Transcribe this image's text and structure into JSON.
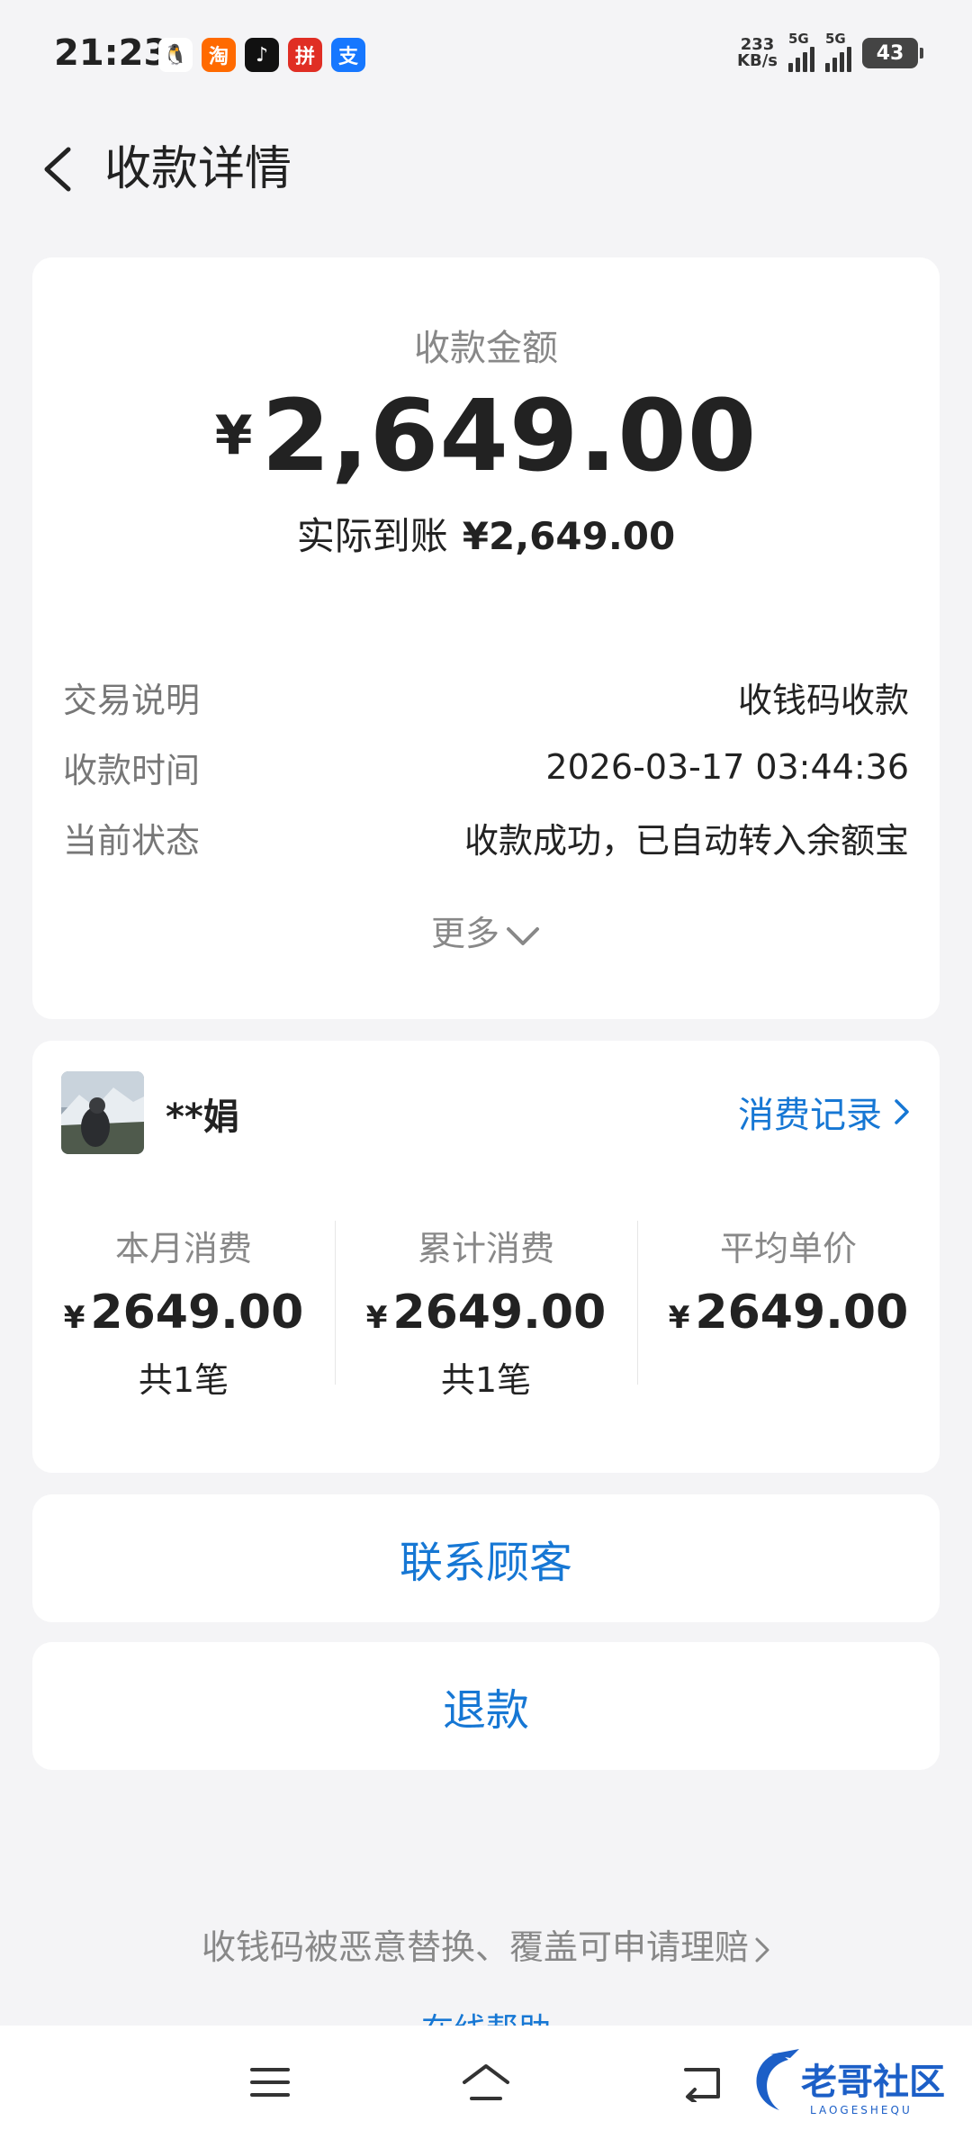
{
  "status_bar": {
    "time": "21:23",
    "apps": [
      {
        "name": "qq-icon",
        "glyph": "🐧",
        "bg": "#ffffff",
        "fg": "#111111"
      },
      {
        "name": "taobao-icon",
        "glyph": "淘",
        "bg": "#ff6a00",
        "fg": "#ffffff"
      },
      {
        "name": "tiktok-icon",
        "glyph": "♪",
        "bg": "#111111",
        "fg": "#ffffff"
      },
      {
        "name": "pinduoduo-icon",
        "glyph": "拼",
        "bg": "#e02e24",
        "fg": "#ffffff"
      },
      {
        "name": "alipay-icon",
        "glyph": "支",
        "bg": "#1677ff",
        "fg": "#ffffff"
      }
    ],
    "net_speed_value": "233",
    "net_speed_unit": "KB/s",
    "sim1": "5G",
    "sim2": "5G",
    "battery": "43"
  },
  "header": {
    "title": "收款详情"
  },
  "summary": {
    "amount_label": "收款金额",
    "currency_symbol": "¥",
    "amount": "2,649.00",
    "arrived_label": "实际到账",
    "arrived_value": "¥2,649.00",
    "details": [
      {
        "key": "交易说明",
        "value": "收钱码收款"
      },
      {
        "key": "收款时间",
        "value": "2026-03-17 03:44:36"
      },
      {
        "key": "当前状态",
        "value": "收款成功，已自动转入余额宝"
      }
    ],
    "more_label": "更多"
  },
  "customer": {
    "name": "**娟",
    "records_label": "消费记录",
    "stats": [
      {
        "label": "本月消费",
        "yen": "¥",
        "value": "2649.00",
        "count": "共1笔"
      },
      {
        "label": "累计消费",
        "yen": "¥",
        "value": "2649.00",
        "count": "共1笔"
      },
      {
        "label": "平均单价",
        "yen": "¥",
        "value": "2649.00",
        "count": ""
      }
    ]
  },
  "actions": {
    "contact_label": "联系顾客",
    "refund_label": "退款"
  },
  "footer": {
    "claim_label": "收钱码被恶意替换、覆盖可申请理赔",
    "help_label": "在线帮助"
  },
  "watermark": {
    "text": "老哥社区",
    "subtext": "LAOGESHEQU"
  },
  "colors": {
    "accent": "#1677d4",
    "background": "#f4f4f6",
    "card": "#ffffff"
  }
}
